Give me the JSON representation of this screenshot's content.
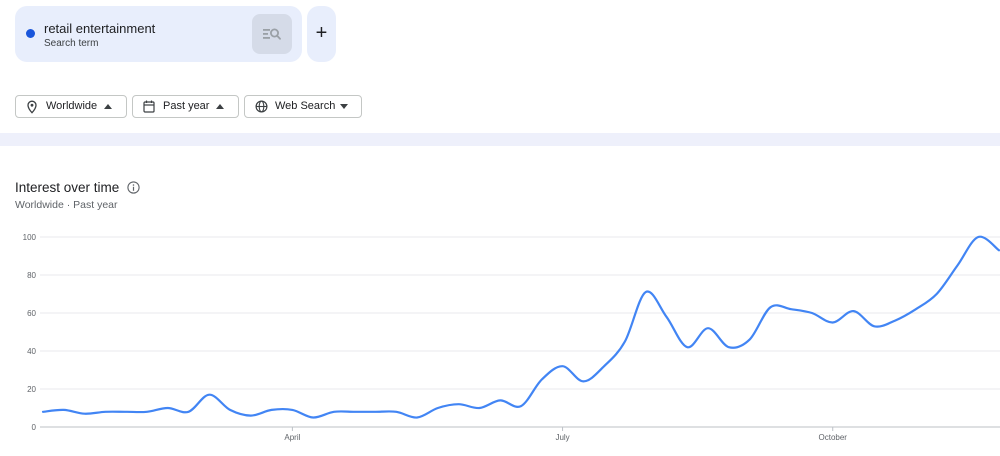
{
  "search_term": {
    "name": "retail entertainment",
    "subtitle": "Search term",
    "color": "#1a56db",
    "action_icon": "search-compare-icon"
  },
  "add_term": {
    "label": "+"
  },
  "filters": {
    "region": {
      "label": "Worldwide",
      "icon": "location-pin-icon"
    },
    "time": {
      "label": "Past year",
      "icon": "calendar-icon"
    },
    "property": {
      "label": "Web Search",
      "icon": "globe-icon"
    }
  },
  "chart": {
    "title": "Interest over time",
    "subtitle": "Worldwide · Past year",
    "info_icon": "info-icon"
  },
  "chart_data": {
    "type": "line",
    "title": "Interest over time",
    "xlabel": "",
    "ylabel": "",
    "ylim": [
      0,
      100
    ],
    "yticks": [
      0,
      20,
      40,
      60,
      80,
      100
    ],
    "grid": true,
    "line_color": "#4285f4",
    "x_tick_labels": [
      {
        "label": "April",
        "week": 12
      },
      {
        "label": "July",
        "week": 25
      },
      {
        "label": "October",
        "week": 38
      }
    ],
    "series": [
      {
        "values": [
          8,
          9,
          7,
          8,
          8,
          8,
          10,
          8,
          17,
          9,
          6,
          9,
          9,
          5,
          8,
          8,
          8,
          8,
          5,
          10,
          12,
          10,
          14,
          11,
          25,
          32,
          24,
          32,
          45,
          71,
          58,
          42,
          52,
          42,
          46,
          63,
          62,
          60,
          55,
          61,
          53,
          56,
          62,
          70,
          85,
          100,
          93
        ]
      }
    ]
  }
}
